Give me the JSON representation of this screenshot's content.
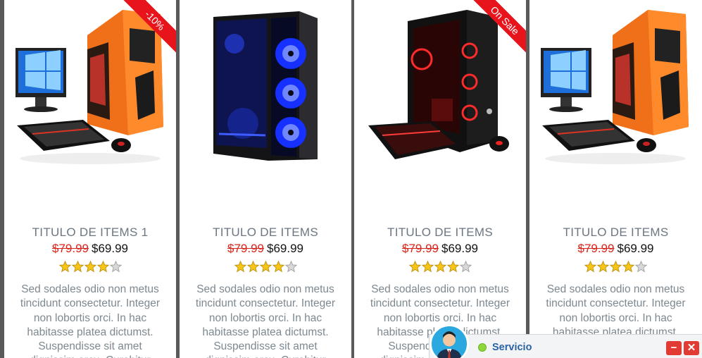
{
  "products": [
    {
      "title": "TITULO DE ITEMS 1",
      "old_price": "$79.99",
      "price": "$69.99",
      "rating": 4,
      "badge": "-10%",
      "image": "orange-gaming-pc",
      "description": "Sed sodales odio non metus tincidunt consectetur. Integer non lobortis orci. In hac habitasse platea dictumst. Suspendisse sit amet dignissim arcu. Curabitur"
    },
    {
      "title": "TITULO DE ITEMS",
      "old_price": "$79.99",
      "price": "$69.99",
      "rating": 4,
      "badge": "",
      "image": "blue-fan-pc-case",
      "description": "Sed sodales odio non metus tincidunt consectetur. Integer non lobortis orci. In hac habitasse platea dictumst. Suspendisse sit amet dignissim arcu. Curabitur"
    },
    {
      "title": "TITULO DE ITEMS",
      "old_price": "$79.99",
      "price": "$69.99",
      "rating": 4,
      "badge": "On Sale",
      "image": "red-gaming-pc",
      "description": "Sed sodales odio non metus tincidunt consectetur. Integer non lobortis orci. In hac habitasse platea dictumst. Suspendisse sit amet dignissim arcu. Curabitur"
    },
    {
      "title": "TITULO DE ITEMS",
      "old_price": "$79.99",
      "price": "$69.99",
      "rating": 4,
      "badge": "",
      "image": "orange-gaming-pc",
      "description": "Sed sodales odio non metus tincidunt consectetur. Integer non lobortis orci. In hac habitasse platea dictumst. Suspendisse sit amet dignissim arcu. Curabitur"
    }
  ],
  "chat": {
    "label": "Servicio",
    "status": "online",
    "minimize": "−",
    "close": "✕"
  },
  "colors": {
    "sale_red": "#e8141c",
    "old_price": "#d9251c",
    "title": "#6b7682",
    "star": "#f5c518",
    "chat_label": "#2a62a8"
  }
}
